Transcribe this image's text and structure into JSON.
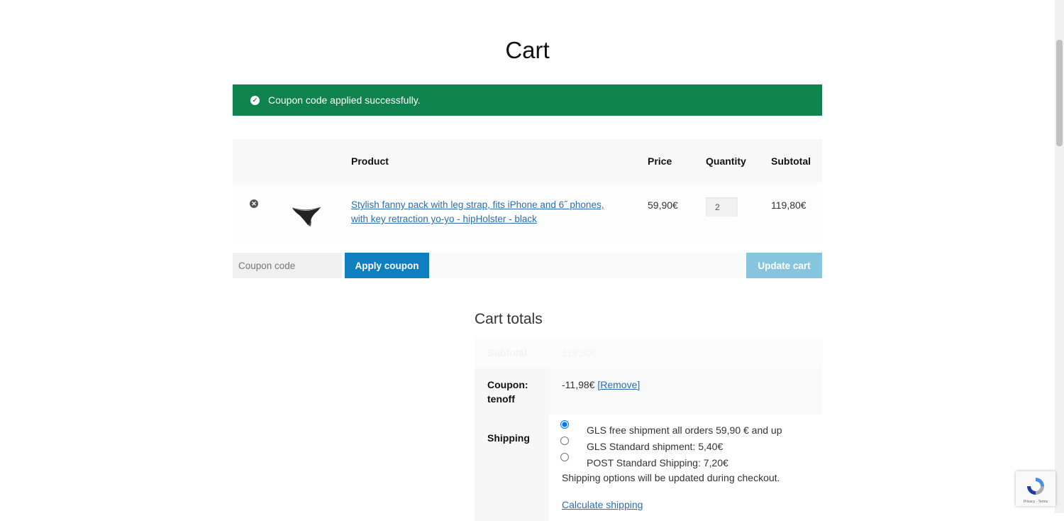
{
  "page": {
    "title": "Cart"
  },
  "notice": {
    "message": "Coupon code applied successfully."
  },
  "table": {
    "headers": {
      "product": "Product",
      "price": "Price",
      "quantity": "Quantity",
      "subtotal": "Subtotal"
    },
    "items": [
      {
        "name": "Stylish fanny pack with leg strap, fits iPhone and 6˝ phones, with key retraction yo-yo - hipHolster - black",
        "price": "59,90€",
        "quantity": "2",
        "subtotal": "119,80€"
      }
    ]
  },
  "actions": {
    "coupon_placeholder": "Coupon code",
    "apply_label": "Apply coupon",
    "update_label": "Update cart"
  },
  "totals": {
    "title": "Cart totals",
    "subtotal_label": "Subtotal",
    "subtotal_value": "119,80€",
    "coupon_label_1": "Coupon:",
    "coupon_label_2": "tenoff",
    "coupon_value": "-11,98€",
    "coupon_remove": "[Remove]",
    "shipping_label": "Shipping",
    "shipping_options": [
      {
        "label": "GLS free shipment all orders 59,90 € and up",
        "selected": true
      },
      {
        "label": "GLS Standard shipment: 5,40€",
        "selected": false
      },
      {
        "label": "POST Standard Shipping: 7,20€",
        "selected": false
      }
    ],
    "shipping_note": "Shipping options will be updated during checkout.",
    "calculate_label": "Calculate shipping"
  },
  "recaptcha": {
    "text": "Privacy - Terms"
  },
  "colors": {
    "success": "#0f834d",
    "primary_button": "#0f7fbf",
    "disabled_button": "#87c5df",
    "link": "#2b6fb0"
  }
}
